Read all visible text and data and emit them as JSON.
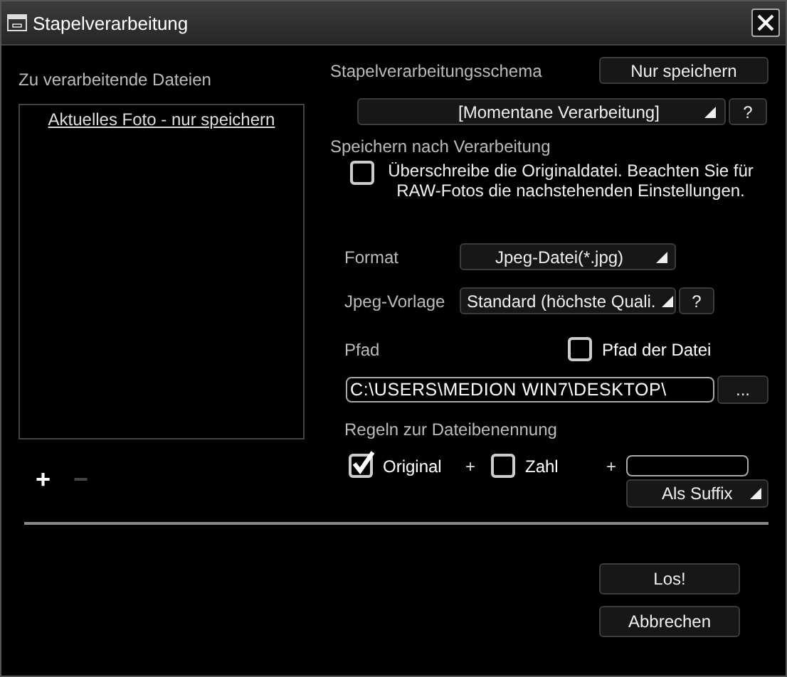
{
  "window": {
    "title": "Stapelverarbeitung"
  },
  "files": {
    "label": "Zu verarbeitende Dateien",
    "items": [
      {
        "text": "Aktuelles Foto - nur speichern"
      }
    ],
    "add_button": {
      "text": "+",
      "disabled": false
    },
    "remove_button": {
      "text": "−",
      "disabled": true
    }
  },
  "schema": {
    "label": "Stapelverarbeitungsschema",
    "save_button": "Nur speichern",
    "dropdown": "[Momentane Verarbeitung]",
    "help": "?"
  },
  "save": {
    "label": "Speichern nach Verarbeitung",
    "overwrite": {
      "text": "Überschreibe die Originaldatei. Beachten Sie für RAW-Fotos die nachstehenden Einstellungen.",
      "checked": false
    }
  },
  "format": {
    "label": "Format",
    "value": "Jpeg-Datei(*.jpg)"
  },
  "jpeg_preset": {
    "label": "Jpeg-Vorlage",
    "value": "Standard (höchste Quali.",
    "help": "?"
  },
  "path": {
    "label": "Pfad",
    "file_path": {
      "text": "Pfad der Datei",
      "checked": false
    },
    "value": "C:\\USERS\\MEDION WIN7\\DESKTOP\\",
    "browse": "..."
  },
  "naming": {
    "label": "Regeln zur Dateibenennung",
    "parts": [
      {
        "text": "Original",
        "checked": true
      },
      {
        "text": "Zahl",
        "checked": false
      }
    ],
    "plus": [
      "+",
      "+"
    ],
    "position": "Als Suffix"
  },
  "buttons": [
    {
      "label": "Los!"
    },
    {
      "label": "Abbrechen"
    }
  ]
}
